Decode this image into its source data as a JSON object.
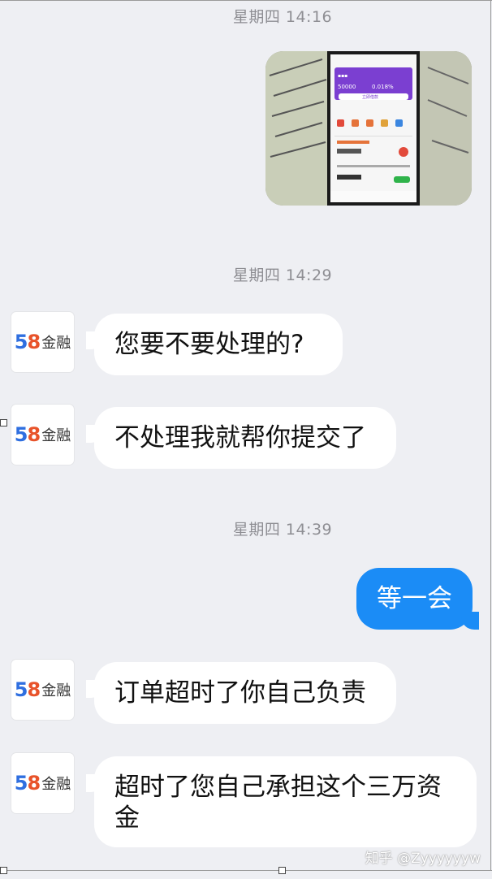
{
  "timestamps": [
    "星期四 14:16",
    "星期四 14:29",
    "星期四 14:39"
  ],
  "avatar": {
    "number": "58",
    "n5": "5",
    "n8": "8",
    "text": "金融"
  },
  "photo": {
    "icon": "phone-screenshot-photo",
    "amount": "50000",
    "rate": "0.018%",
    "button": "立即借款"
  },
  "messages": [
    {
      "side": "in",
      "text": "您要不要处理的?"
    },
    {
      "side": "in",
      "text": "不处理我就帮你提交了"
    },
    {
      "side": "out",
      "text": "等一会"
    },
    {
      "side": "in",
      "text": "订单超时了你自己负责"
    },
    {
      "side": "in",
      "text": "超时了您自己承担这个三万资金"
    }
  ],
  "watermark": "知乎 @Zyyyyyyw",
  "colors": {
    "background": "#eeeff3",
    "outgoing": "#1b8cf6",
    "incoming": "#ffffff"
  }
}
